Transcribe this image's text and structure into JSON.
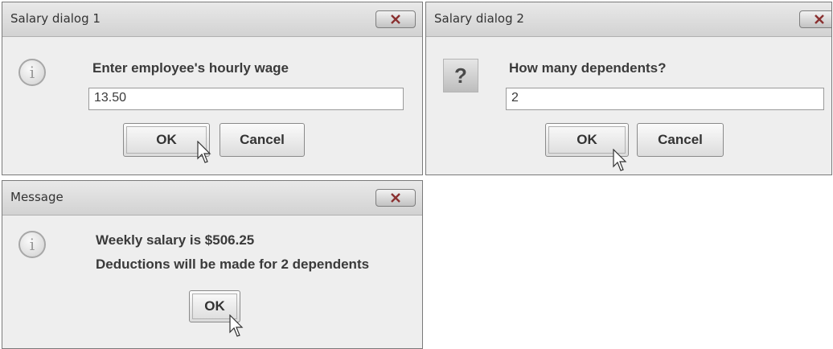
{
  "dialogs": [
    {
      "title": "Salary dialog 1",
      "prompt": "Enter employee's hourly wage",
      "input_value": "13.50",
      "ok_label": "OK",
      "cancel_label": "Cancel",
      "icon": "info-icon"
    },
    {
      "title": "Salary dialog 2",
      "prompt": "How many dependents?",
      "input_value": "2",
      "ok_label": "OK",
      "cancel_label": "Cancel",
      "icon": "question-icon"
    },
    {
      "title": "Message",
      "line1": "Weekly salary is $506.25",
      "line2": "Deductions will be made for 2 dependents",
      "ok_label": "OK",
      "icon": "info-icon"
    }
  ],
  "close_icon_color": "#c23b3b"
}
